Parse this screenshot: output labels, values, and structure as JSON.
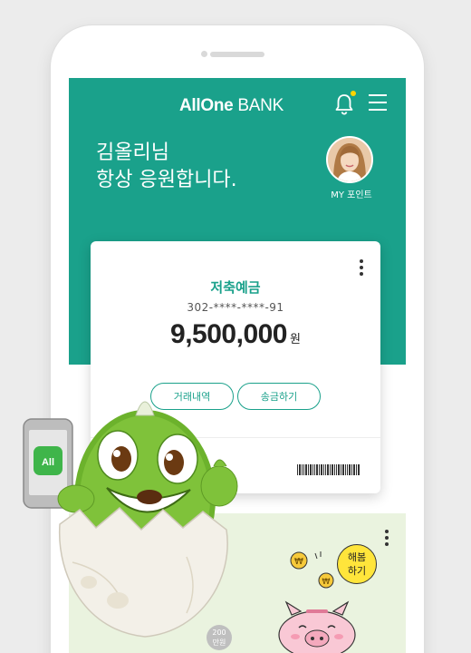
{
  "header": {
    "logo_bold": "AllOne",
    "logo_bank": "BANK"
  },
  "greeting": {
    "line1": "김올리님",
    "line2": "항상 응원합니다."
  },
  "profile": {
    "point_label": "MY 포인트"
  },
  "account_card": {
    "type": "저축예금",
    "number": "302-****-****-91",
    "balance": "9,500,000",
    "currency": "원",
    "history_button": "거래내역",
    "transfer_button": "송금하기"
  },
  "banner": {
    "bubble_line1": "해봄",
    "bubble_line2": "하기",
    "coin_value": "200",
    "coin_unit": "만원"
  },
  "phone_screen_icon": "All",
  "colors": {
    "primary": "#1aa18b",
    "notification_dot": "#ffd400",
    "banner_bg": "#eaf3df",
    "bubble": "#ffe53b"
  },
  "icons": [
    "bell-icon",
    "menu-icon",
    "more-icon",
    "barcode-icon",
    "avatar"
  ]
}
